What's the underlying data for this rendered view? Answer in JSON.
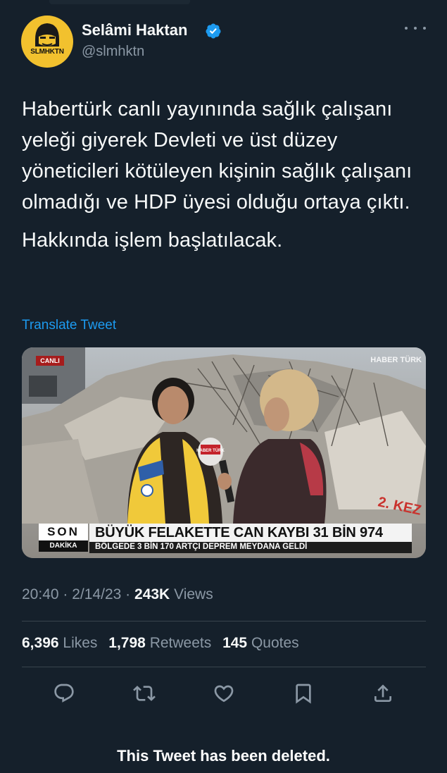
{
  "user": {
    "name": "Selâmi Haktan",
    "handle": "@slmhktn",
    "avatar_text": "SLMHKTN",
    "verified_icon": "verified-badge-icon"
  },
  "tweet": {
    "paragraph_1": "Habertürk canlı yayınında sağlık çalışanı yeleği giyerek Devleti ve üst düzey yöneticileri kötüleyen kişinin sağlık çalışanı olmadığı ve HDP üyesi olduğu ortaya çıktı.",
    "paragraph_2": "Hakkında işlem başlatılacak.",
    "translate_label": "Translate Tweet"
  },
  "media": {
    "live_badge": "CANLI",
    "channel_logo": "HABER TÜRK",
    "breaking_top": "SON",
    "breaking_bottom": "DAKİKA",
    "headline": "BÜYÜK FELAKETTE CAN KAYBI 31 BİN 974",
    "subheadline": "BÖLGEDE 3 BİN 170 ARTÇI DEPREM MEYDANA GELDİ",
    "mic_label": "HABER TÜRK",
    "wall_graffiti": "2. KEZ"
  },
  "meta": {
    "time": "20:40",
    "separator": "·",
    "date": "2/14/23",
    "views_count": "243K",
    "views_label": "Views"
  },
  "stats": {
    "likes_count": "6,396",
    "likes_label": "Likes",
    "retweets_count": "1,798",
    "retweets_label": "Retweets",
    "quotes_count": "145",
    "quotes_label": "Quotes"
  },
  "actions": [
    "reply-icon",
    "retweet-icon",
    "like-icon",
    "bookmark-icon",
    "share-icon"
  ],
  "colors": {
    "background": "#15202b",
    "text": "#f7f9f9",
    "muted": "#8b98a5",
    "link": "#1d9bf0",
    "divider": "#38444d"
  },
  "footer": {
    "deleted_notice": "This Tweet has been deleted."
  }
}
